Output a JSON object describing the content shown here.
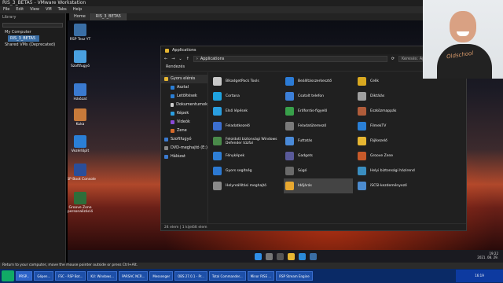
{
  "vm": {
    "title": "RIS_3_BETA5 - VMware Workstation",
    "menu": [
      "File",
      "Edit",
      "View",
      "VM",
      "Tabs",
      "Help"
    ],
    "tabs": [
      "Home",
      "RIS_3_BETA5"
    ],
    "hint": "Return to your computer, move the mouse pointer outside or press Ctrl+Alt."
  },
  "library": {
    "title": "Library",
    "items": [
      "My Computer",
      "RIS_3_BETA5",
      "Shared VMs (Deprecated)"
    ]
  },
  "desktop_icons": [
    {
      "label": "RSP Tesz YT"
    },
    {
      "label": "Szoftfugyó"
    },
    {
      "label": "Hálózat"
    },
    {
      "label": "Kuka"
    },
    {
      "label": "VezérlőpIt"
    },
    {
      "label": "RSP Boot Console"
    },
    {
      "label": "Groove Zone personalizáció"
    }
  ],
  "explorer": {
    "title": "Applications",
    "path": [
      "Applications"
    ],
    "search_placeholder": "Keresés: Applications",
    "cmd": "Rendezés",
    "nav": [
      {
        "label": "Gyors elérés",
        "kind": "top"
      },
      {
        "label": "Asztal",
        "kind": "child"
      },
      {
        "label": "Letöltések",
        "kind": "child"
      },
      {
        "label": "Dokumentumok",
        "kind": "child"
      },
      {
        "label": "Képek",
        "kind": "child"
      },
      {
        "label": "Videók",
        "kind": "child"
      },
      {
        "label": "Zene",
        "kind": "child"
      },
      {
        "label": "Szoftfugyó",
        "kind": "group"
      },
      {
        "label": "DVD-meghajtó (E:)",
        "kind": "group"
      },
      {
        "label": "Hálózat",
        "kind": "group"
      }
    ],
    "apps": [
      {
        "label": "BlkadgetPack Tools",
        "color": "#c9c9c9"
      },
      {
        "label": "Beállításszerkesztő",
        "color": "#2b7bd6"
      },
      {
        "label": "Celik",
        "color": "#d8a820"
      },
      {
        "label": "Cortana",
        "color": "#1fa3e0"
      },
      {
        "label": "Csatolt telefon",
        "color": "#3c7fd8"
      },
      {
        "label": "Diktálás",
        "color": "#a0a0a0"
      },
      {
        "label": "Első lépések",
        "color": "#2a9ee0"
      },
      {
        "label": "Erőforrás-figyelő",
        "color": "#38a04a"
      },
      {
        "label": "Eszközmappák",
        "color": "#b05c3a"
      },
      {
        "label": "Feladatkezelő",
        "color": "#3c6fd0"
      },
      {
        "label": "Feladatütemező",
        "color": "#7a7a7a"
      },
      {
        "label": "FilmekTV",
        "color": "#2a7fd6"
      },
      {
        "label": "Feloldott biztonsági Windows Defender tűzfal",
        "color": "#4a8a4a"
      },
      {
        "label": "Futtatás",
        "color": "#4a8ad8"
      },
      {
        "label": "Fájlkezelő",
        "color": "#e6b632"
      },
      {
        "label": "Fényképek",
        "color": "#2e7fd6"
      },
      {
        "label": "Gadgets",
        "color": "#5a5a9a"
      },
      {
        "label": "Groove Zene",
        "color": "#c85a2a"
      },
      {
        "label": "Gyors segítség",
        "color": "#2c79d2"
      },
      {
        "label": "Súgó",
        "color": "#6a6a6a"
      },
      {
        "label": "Helyi biztonsági házirend",
        "color": "#3a8ec0"
      },
      {
        "label": "Helyreállítási meghajtó",
        "color": "#8a8a8a"
      },
      {
        "label": "Időjárás",
        "color": "#e8a830"
      },
      {
        "label": "iSCSI-kezdeményező",
        "color": "#4c8cd0"
      }
    ],
    "selected_app": "Időjárás",
    "status": "24 elem  |  1 kijelölt elem"
  },
  "webcam": {
    "shirt_text": "Oldschool"
  },
  "guest_clock": {
    "time": "19:22",
    "date": "2021. 08. 29."
  },
  "host_taskbar": {
    "tasks": [
      "PRSP...",
      "Gépen...",
      "FSC - RSP Bot...",
      "KU: Windows...",
      "PARSAC NCR...",
      "Messenger",
      "OBS 27.0.1 - Pr...",
      "Total Commander...",
      "Minor RISE ...",
      "RSP Stream Engine"
    ],
    "tray": "16:19"
  },
  "colors": {
    "accent": "#3a6ea5",
    "explorer_bg": "#202020",
    "host_taskbar": "#0a2a66"
  }
}
